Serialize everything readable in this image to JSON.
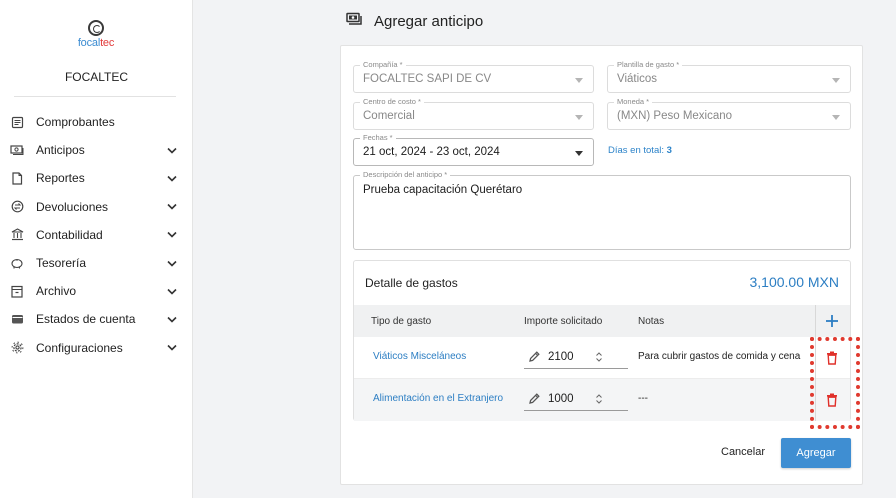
{
  "brand": {
    "logo_text_a": "focal",
    "logo_text_b": "tec",
    "org_name": "FOCALTEC"
  },
  "sidebar": {
    "items": [
      {
        "label": "Comprobantes",
        "icon": "receipt-icon",
        "has_children": false
      },
      {
        "label": "Anticipos",
        "icon": "cash-icon",
        "has_children": true
      },
      {
        "label": "Reportes",
        "icon": "document-icon",
        "has_children": true
      },
      {
        "label": "Devoluciones",
        "icon": "exchange-icon",
        "has_children": true
      },
      {
        "label": "Contabilidad",
        "icon": "bank-icon",
        "has_children": true
      },
      {
        "label": "Tesorería",
        "icon": "piggy-bank-icon",
        "has_children": true
      },
      {
        "label": "Archivo",
        "icon": "archive-icon",
        "has_children": true
      },
      {
        "label": "Estados de cuenta",
        "icon": "wallet-icon",
        "has_children": true
      },
      {
        "label": "Configuraciones",
        "icon": "gear-icon",
        "has_children": true
      }
    ]
  },
  "header": {
    "title": "Agregar anticipo",
    "icon": "cash-icon"
  },
  "form": {
    "company": {
      "label": "Compañía *",
      "value": "FOCALTEC SAPI DE CV"
    },
    "template": {
      "label": "Plantilla de gasto *",
      "value": "Viáticos"
    },
    "cost_center": {
      "label": "Centro de costo *",
      "value": "Comercial"
    },
    "currency": {
      "label": "Moneda *",
      "value": "(MXN) Peso Mexicano"
    },
    "dates": {
      "label": "Fechas *",
      "value": "21 oct, 2024 - 23 oct, 2024"
    },
    "days_total_label": "Días en total:",
    "days_total_value": "3",
    "description": {
      "label": "Descripción del anticipo *",
      "value": "Prueba capacitación Querétaro"
    }
  },
  "details": {
    "title": "Detalle de gastos",
    "total": "3,100.00 MXN",
    "columns": [
      "Tipo de gasto",
      "Importe solicitado",
      "Notas"
    ],
    "rows": [
      {
        "tipo": "Viáticos Misceláneos",
        "importe": "2100",
        "notas": "Para cubrir gastos de comida y cena"
      },
      {
        "tipo": "Alimentación en el Extranjero",
        "importe": "1000",
        "notas": "---"
      }
    ]
  },
  "actions": {
    "cancel": "Cancelar",
    "add": "Agregar"
  },
  "colors": {
    "accent": "#3f8ed2",
    "link": "#2c7ec3",
    "danger": "#e03a2f"
  }
}
